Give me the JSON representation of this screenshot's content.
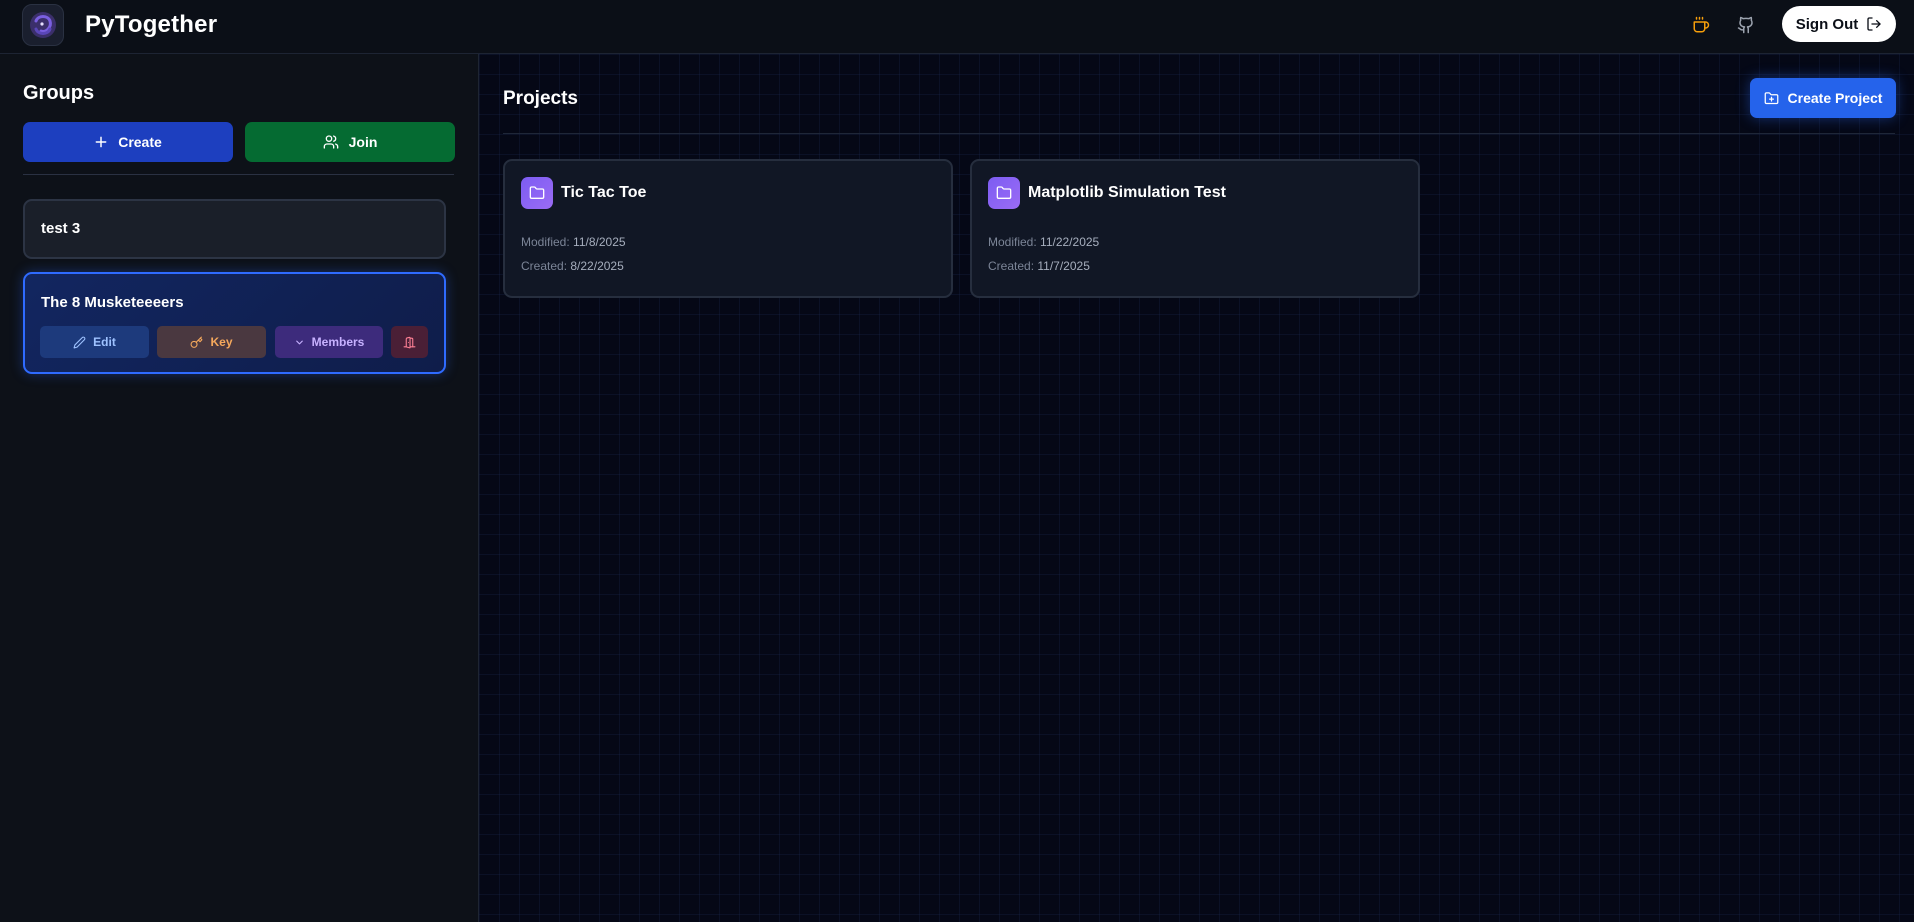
{
  "app": {
    "title": "PyTogether"
  },
  "header": {
    "sign_out_label": "Sign Out"
  },
  "sidebar": {
    "title": "Groups",
    "create_label": "Create",
    "join_label": "Join",
    "groups": [
      {
        "name": "test 3"
      },
      {
        "name": "The 8 Musketeeeers",
        "selected": true,
        "actions": {
          "edit": "Edit",
          "key": "Key",
          "members": "Members"
        }
      }
    ]
  },
  "main": {
    "title": "Projects",
    "create_project_label": "Create Project",
    "modified_label": "Modified:",
    "created_label": "Created:",
    "projects": [
      {
        "name": "Tic Tac Toe",
        "modified": "11/8/2025",
        "created": "8/22/2025"
      },
      {
        "name": "Matplotlib Simulation Test",
        "modified": "11/22/2025",
        "created": "11/7/2025"
      }
    ]
  },
  "icons": {
    "logo": "pytogether-logo-icon",
    "coffee": "coffee-icon",
    "github": "github-icon",
    "sign_out": "sign-out-icon",
    "plus": "plus-icon",
    "users": "users-icon",
    "pencil": "pencil-icon",
    "key": "key-icon",
    "chevron": "chevron-down-icon",
    "door": "door-exit-icon",
    "folder": "folder-icon",
    "folder_plus": "folder-plus-icon"
  },
  "colors": {
    "background": "#050816",
    "sidebar": "#0d1118",
    "create": "#1d3fbf",
    "join": "#056b32",
    "accent": "#2563eb",
    "selected_border": "#2f6bff",
    "folder_badge": "#7c5cf2",
    "coffee": "#f59e0b"
  }
}
